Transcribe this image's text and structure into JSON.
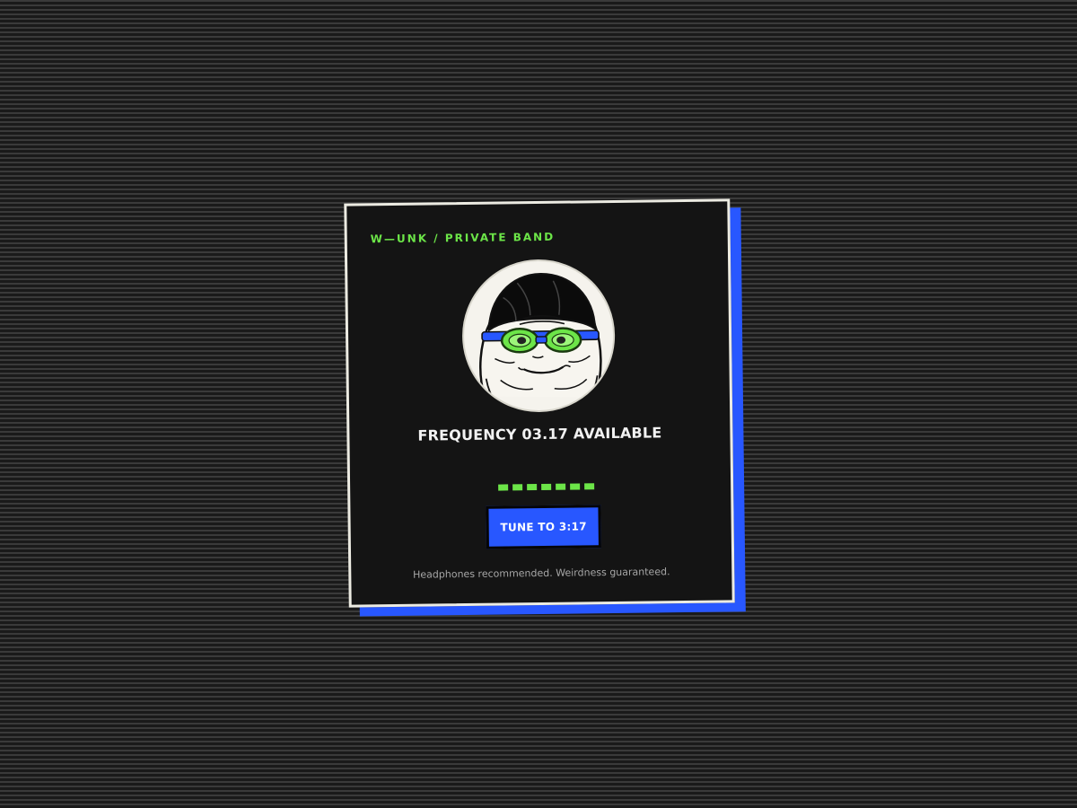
{
  "card": {
    "brand": "W—UNK / PRIVATE BAND",
    "avatar": {
      "icon": "frog-swimmer-goggles-icon",
      "skin": "#f5f3ed",
      "goggle_lens": "#6ce548",
      "goggle_strap": "#2857ff"
    },
    "headline": "FREQUENCY 03.17 AVAILABLE",
    "signal": {
      "icon": "signal-dots-icon",
      "segments": 7,
      "color": "#6ce548"
    },
    "tune_button": {
      "label": "TUNE TO 3:17"
    },
    "footnote": "Headphones recommended. Weirdness guaranteed."
  },
  "colors": {
    "accent_green": "#6ce548",
    "accent_blue": "#2857ff",
    "card_bg": "#141414",
    "card_border": "#ecebe2"
  }
}
